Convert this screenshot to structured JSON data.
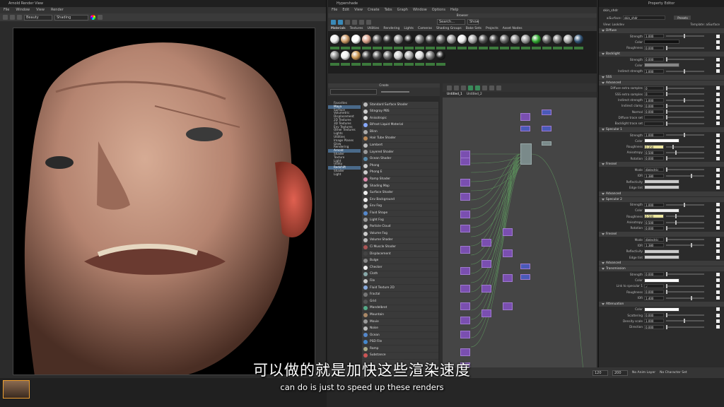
{
  "render_view": {
    "title": "Arnold Render View",
    "menu": [
      "File",
      "Window",
      "View",
      "Render"
    ],
    "channel": "Beauty",
    "shading": "Shading"
  },
  "hypershade": {
    "title": "Hypershade",
    "menu": [
      "File",
      "Edit",
      "View",
      "Create",
      "Tabs",
      "Graph",
      "Window",
      "Options",
      "Help"
    ],
    "browser_title": "Browser",
    "search_placeholder": "Search...",
    "show_label": "Show",
    "tabs": [
      "Materials",
      "Textures",
      "Utilities",
      "Rendering",
      "Lights",
      "Cameras",
      "Shading Groups",
      "Bake Sets",
      "Projects",
      "Asset Nodes"
    ],
    "create_title": "Create",
    "categories": [
      "Favorites",
      "Maya",
      "Surface",
      "Volumetric",
      "Displacement",
      "2D Textures",
      "3D Textures",
      "Env Textures",
      "Other Textures",
      "Lights",
      "Utilities",
      "Image Planes",
      "Glow",
      "Rendering",
      "Arnold",
      "Shader",
      "Texture",
      "Light",
      "Utility",
      "Redshift",
      "Shader",
      "Light"
    ],
    "shaders": [
      "Standard Surface Shader",
      "Stingray PBS",
      "Anisotropic",
      "Bifrost Liquid Material",
      "Blinn",
      "Hair Tube Shader",
      "Lambert",
      "Layered Shader",
      "Ocean Shader",
      "Phong",
      "Phong E",
      "Ramp Shader",
      "Shading Map",
      "Surface Shader",
      "Env Background",
      "Env Fog",
      "Fluid Shape",
      "Light Fog",
      "Particle Cloud",
      "Volume Fog",
      "Volume Shader",
      "Ci Muscle Shader",
      "Displacement",
      "Bulge",
      "Checker",
      "Cloth",
      "File",
      "Fluid Texture 2D",
      "Fractal",
      "Grid",
      "Mandelbrot",
      "Mountain",
      "Movie",
      "Noise",
      "Ocean",
      "PSD File",
      "Ramp",
      "Substance"
    ],
    "graph_tabs": [
      "Untitled_1",
      "Untitled_2"
    ]
  },
  "property_editor": {
    "title": "Property Editor",
    "node": "skin_shdr",
    "type_label": "aiSurface:",
    "type_value": "skin_shdr",
    "presets": "Presets",
    "view_label": "View: Lookdev",
    "template": "Template: aiSurface",
    "sections": [
      {
        "name": "Diffuse",
        "rows": [
          {
            "label": "Strength",
            "value": "1.000"
          },
          {
            "label": "Color",
            "value": ""
          },
          {
            "label": "Roughness",
            "value": "0.000"
          }
        ]
      },
      {
        "name": "Backlight",
        "rows": [
          {
            "label": "Strength",
            "value": "0.000"
          },
          {
            "label": "Color",
            "value": ""
          },
          {
            "label": "Indirect strength",
            "value": "1.000"
          }
        ]
      },
      {
        "name": "SSS",
        "rows": []
      },
      {
        "name": "Advanced",
        "rows": [
          {
            "label": "Diffuse extra samples",
            "value": "0"
          },
          {
            "label": "SSS extra samples",
            "value": "0"
          },
          {
            "label": "Indirect strength",
            "value": "1.000"
          },
          {
            "label": "Indirect clamp",
            "value": "0.000"
          },
          {
            "label": "Normal",
            "value": "0.000"
          },
          {
            "label": "Diffuse trace set",
            "value": ""
          },
          {
            "label": "Backlight trace set",
            "value": ""
          }
        ]
      },
      {
        "name": "Specular 1",
        "rows": [
          {
            "label": "Strength",
            "value": "1.000"
          },
          {
            "label": "Color",
            "value": ""
          },
          {
            "label": "Roughness",
            "value": "0.350"
          },
          {
            "label": "Anisotropy",
            "value": "0.500"
          },
          {
            "label": "Rotation",
            "value": "0.000"
          }
        ]
      },
      {
        "name": "Fresnel",
        "rows": [
          {
            "label": "Mode",
            "value": "dielectric"
          },
          {
            "label": "IOR",
            "value": "1.380"
          },
          {
            "label": "Reflectivity",
            "value": ""
          },
          {
            "label": "Edge tint",
            "value": ""
          }
        ]
      },
      {
        "name": "Advanced",
        "rows": []
      },
      {
        "name": "Specular 2",
        "rows": [
          {
            "label": "Strength",
            "value": "1.000"
          },
          {
            "label": "Color",
            "value": ""
          },
          {
            "label": "Roughness",
            "value": "0.500"
          },
          {
            "label": "Anisotropy",
            "value": "0.500"
          },
          {
            "label": "Rotation",
            "value": "0.000"
          }
        ]
      },
      {
        "name": "Fresnel",
        "rows": [
          {
            "label": "Mode",
            "value": "dielectric"
          },
          {
            "label": "IOR",
            "value": "1.380"
          },
          {
            "label": "Reflectivity",
            "value": ""
          },
          {
            "label": "Edge tint",
            "value": ""
          }
        ]
      },
      {
        "name": "Advanced",
        "rows": []
      },
      {
        "name": "Transmission",
        "rows": [
          {
            "label": "Strength",
            "value": "0.000"
          },
          {
            "label": "Color",
            "value": ""
          },
          {
            "label": "Link to specular 1",
            "value": "✓"
          },
          {
            "label": "Roughness",
            "value": "0.000"
          },
          {
            "label": "IOR",
            "value": "1.400"
          }
        ]
      },
      {
        "name": "Attenuation",
        "rows": [
          {
            "label": "Color",
            "value": ""
          },
          {
            "label": "Scattering",
            "value": "0.000"
          },
          {
            "label": "Density scale",
            "value": "1.000"
          },
          {
            "label": "Direction",
            "value": "0.000"
          }
        ]
      }
    ]
  },
  "timeline": {
    "start": "120",
    "end": "200",
    "anim_layer": "No Anim Layer",
    "char_set": "No Character Set"
  },
  "subtitle": {
    "zh": "可以做的就是加快这些渲染速度",
    "en": "can do is just to speed up these renders"
  },
  "colors": {
    "accent": "#4a6a8a",
    "node_purple": "#7a4fb0"
  }
}
